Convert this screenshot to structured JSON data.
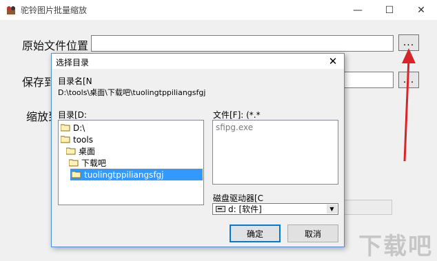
{
  "window": {
    "title": "驼铃图片批量缩放",
    "min_glyph": "—",
    "max_glyph": "☐",
    "close_glyph": "✕"
  },
  "main": {
    "source_label": "原始文件位置",
    "save_label": "保存到",
    "scale_label": "缩放到",
    "browse_label": "...",
    "browse2_label": "..."
  },
  "dialog": {
    "title": "选择目录",
    "close_glyph": "✕",
    "dirname_label": "目录名[N",
    "current_path": "D:\\tools\\桌面\\下载吧\\tuolingtppiliangsfgj",
    "dir_label": "目录[D:",
    "files_label": "文件[F]: (*.*",
    "tree": [
      {
        "label": "D:\\",
        "level": 0,
        "selected": false
      },
      {
        "label": "tools",
        "level": 1,
        "selected": false
      },
      {
        "label": "桌面",
        "level": 2,
        "selected": false
      },
      {
        "label": "下载吧",
        "level": 3,
        "selected": false
      },
      {
        "label": "tuolingtppiliangsfgj",
        "level": 4,
        "selected": true
      }
    ],
    "files": [
      "sfipg.exe"
    ],
    "drive_label": "磁盘驱动器[C",
    "drive_value": "d: [软件]",
    "ok_label": "确定",
    "cancel_label": "取消"
  },
  "watermark": "下载吧",
  "colors": {
    "accent": "#0078d7",
    "selection": "#3399ff",
    "arrow": "#d9232b"
  }
}
